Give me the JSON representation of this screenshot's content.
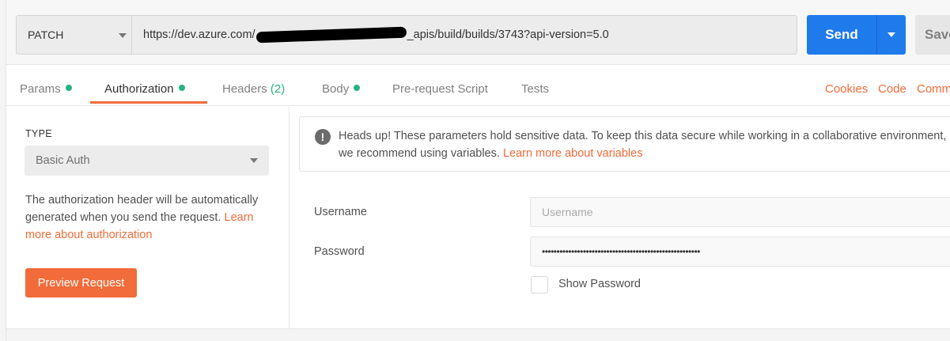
{
  "request": {
    "method": "PATCH",
    "url_prefix": "https://dev.azure.com/",
    "url_suffix": "_apis/build/builds/3743?api-version=5.0",
    "send_label": "Send",
    "save_label": "Save"
  },
  "tabs": [
    {
      "label": "Params",
      "dot": true
    },
    {
      "label": "Authorization",
      "dot": true,
      "active": true
    },
    {
      "label": "Headers",
      "count": "(2)"
    },
    {
      "label": "Body",
      "dot": true
    },
    {
      "label": "Pre-request Script"
    },
    {
      "label": "Tests"
    }
  ],
  "right_links": [
    "Cookies",
    "Code",
    "Comm"
  ],
  "auth": {
    "type_label": "TYPE",
    "type_value": "Basic Auth",
    "description": "The authorization header will be automatically generated when you send the request. ",
    "description_link": "Learn more about authorization",
    "preview_label": "Preview Request"
  },
  "notice": {
    "icon": "exclamation-icon",
    "text": "Heads up! These parameters hold sensitive data. To keep this data secure while working in a collaborative environment, we recommend using variables. ",
    "link": "Learn more about variables"
  },
  "fields": {
    "username_label": "Username",
    "username_placeholder": "Username",
    "username_value": "",
    "password_label": "Password",
    "password_value": "••••••••••••••••••••••••••••••••••••••••••••••••••••••",
    "show_password_label": "Show Password",
    "show_password_checked": false
  },
  "colors": {
    "accent": "#f26b3a",
    "send": "#1f7aec",
    "status_dot": "#26b47f"
  }
}
